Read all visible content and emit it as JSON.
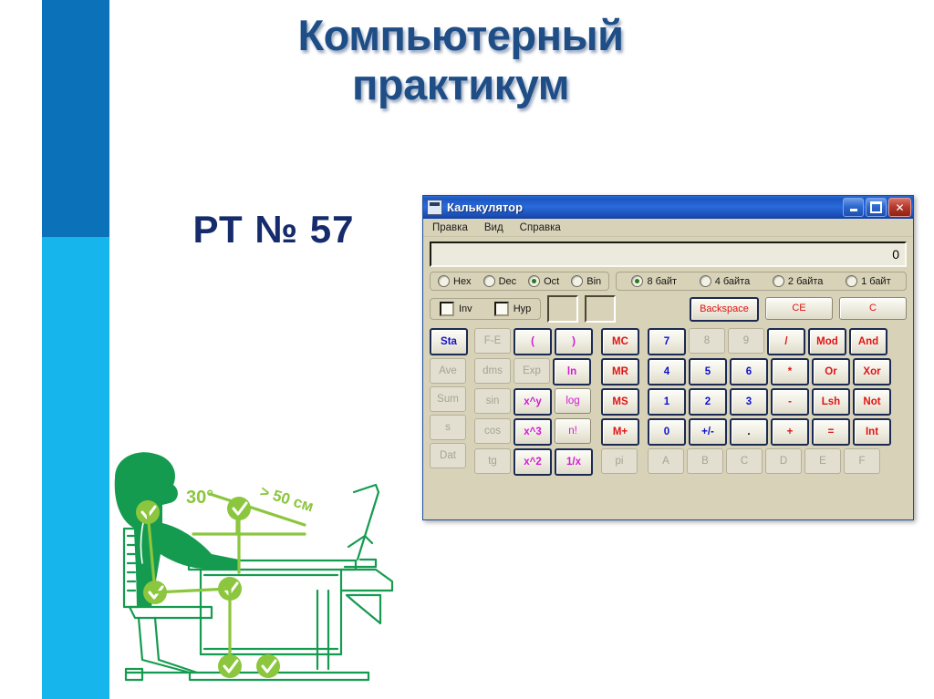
{
  "slide": {
    "title_line1": "Компьютерный",
    "title_line2": "практикум",
    "subtitle": "РТ № 57",
    "title_color": "#1f4e87",
    "subtitle_color": "#152b6b",
    "bar_dark_color": "#0b72ba",
    "bar_light_color": "#16b6ec"
  },
  "illustration": {
    "name": "ergonomic-desk-posture-diagram",
    "angle_label": "30°",
    "distance_label": "> 50 см",
    "line_color": "#159b4f",
    "accent_color": "#8cc63e"
  },
  "calculator": {
    "window_title": "Калькулятор",
    "window_icon": "calculator-icon",
    "window_buttons": {
      "minimize": "minimize-icon",
      "maximize": "maximize-icon",
      "close": "✕"
    },
    "menu": [
      "Правка",
      "Вид",
      "Справка"
    ],
    "display_value": "0",
    "number_system": {
      "options": [
        "Hex",
        "Dec",
        "Oct",
        "Bin"
      ],
      "selected": "Oct"
    },
    "word_size": {
      "options": [
        "8 байт",
        "4 байта",
        "2 байта",
        "1 байт"
      ],
      "selected": "8 байт"
    },
    "flags": [
      {
        "label": "Inv",
        "checked": false
      },
      {
        "label": "Hyp",
        "checked": false
      }
    ],
    "indicators": [
      "",
      ""
    ],
    "edit_buttons": [
      {
        "label": "Backspace",
        "color": "red",
        "focus": true
      },
      {
        "label": "CE",
        "color": "red",
        "focus": false
      },
      {
        "label": "C",
        "color": "red",
        "focus": false
      }
    ],
    "keypad": {
      "stat_column": [
        {
          "label": "Sta",
          "color": "blue",
          "disabled": false,
          "focus": true
        },
        {
          "label": "Ave",
          "color": "black",
          "disabled": true,
          "focus": false
        },
        {
          "label": "Sum",
          "color": "black",
          "disabled": true,
          "focus": false
        },
        {
          "label": "s",
          "color": "black",
          "disabled": true,
          "focus": false
        },
        {
          "label": "Dat",
          "color": "black",
          "disabled": true,
          "focus": false
        }
      ],
      "func_block": [
        [
          {
            "label": "F-E",
            "color": "black",
            "disabled": true,
            "focus": false
          },
          {
            "label": "(",
            "color": "magenta",
            "disabled": false,
            "focus": true
          },
          {
            "label": ")",
            "color": "magenta",
            "disabled": false,
            "focus": true
          }
        ],
        [
          {
            "label": "dms",
            "color": "black",
            "disabled": true,
            "focus": false
          },
          {
            "label": "Exp",
            "color": "black",
            "disabled": true,
            "focus": false
          },
          {
            "label": "ln",
            "color": "magenta",
            "disabled": false,
            "focus": true
          }
        ],
        [
          {
            "label": "sin",
            "color": "black",
            "disabled": true,
            "focus": false
          },
          {
            "label": "x^y",
            "color": "magenta",
            "disabled": false,
            "focus": true
          },
          {
            "label": "log",
            "color": "magenta",
            "disabled": false,
            "focus": false
          }
        ],
        [
          {
            "label": "cos",
            "color": "black",
            "disabled": true,
            "focus": false
          },
          {
            "label": "x^3",
            "color": "magenta",
            "disabled": false,
            "focus": true
          },
          {
            "label": "n!",
            "color": "magenta",
            "disabled": false,
            "focus": false
          }
        ],
        [
          {
            "label": "tg",
            "color": "black",
            "disabled": true,
            "focus": false
          },
          {
            "label": "x^2",
            "color": "magenta",
            "disabled": false,
            "focus": true
          },
          {
            "label": "1/x",
            "color": "magenta",
            "disabled": false,
            "focus": true
          }
        ]
      ],
      "memory_column": [
        {
          "label": "MC",
          "color": "red",
          "disabled": false,
          "focus": true
        },
        {
          "label": "MR",
          "color": "red",
          "disabled": false,
          "focus": true
        },
        {
          "label": "MS",
          "color": "red",
          "disabled": false,
          "focus": true
        },
        {
          "label": "M+",
          "color": "red",
          "disabled": false,
          "focus": true
        },
        {
          "label": "pi",
          "color": "black",
          "disabled": true,
          "focus": false
        }
      ],
      "main_block": [
        [
          {
            "label": "7",
            "color": "blue",
            "disabled": false,
            "focus": true
          },
          {
            "label": "8",
            "color": "black",
            "disabled": true,
            "focus": false
          },
          {
            "label": "9",
            "color": "black",
            "disabled": true,
            "focus": false
          },
          {
            "label": "/",
            "color": "red",
            "disabled": false,
            "focus": true
          },
          {
            "label": "Mod",
            "color": "red",
            "disabled": false,
            "focus": true
          },
          {
            "label": "And",
            "color": "red",
            "disabled": false,
            "focus": true
          }
        ],
        [
          {
            "label": "4",
            "color": "blue",
            "disabled": false,
            "focus": true
          },
          {
            "label": "5",
            "color": "blue",
            "disabled": false,
            "focus": true
          },
          {
            "label": "6",
            "color": "blue",
            "disabled": false,
            "focus": true
          },
          {
            "label": "*",
            "color": "red",
            "disabled": false,
            "focus": true
          },
          {
            "label": "Or",
            "color": "red",
            "disabled": false,
            "focus": true
          },
          {
            "label": "Xor",
            "color": "red",
            "disabled": false,
            "focus": true
          }
        ],
        [
          {
            "label": "1",
            "color": "blue",
            "disabled": false,
            "focus": true
          },
          {
            "label": "2",
            "color": "blue",
            "disabled": false,
            "focus": true
          },
          {
            "label": "3",
            "color": "blue",
            "disabled": false,
            "focus": true
          },
          {
            "label": "-",
            "color": "red",
            "disabled": false,
            "focus": true
          },
          {
            "label": "Lsh",
            "color": "red",
            "disabled": false,
            "focus": true
          },
          {
            "label": "Not",
            "color": "red",
            "disabled": false,
            "focus": true
          }
        ],
        [
          {
            "label": "0",
            "color": "blue",
            "disabled": false,
            "focus": true
          },
          {
            "label": "+/-",
            "color": "blue",
            "disabled": false,
            "focus": true
          },
          {
            "label": ".",
            "color": "black",
            "disabled": false,
            "focus": true
          },
          {
            "label": "+",
            "color": "red",
            "disabled": false,
            "focus": true
          },
          {
            "label": "=",
            "color": "red",
            "disabled": false,
            "focus": true
          },
          {
            "label": "Int",
            "color": "red",
            "disabled": false,
            "focus": true
          }
        ],
        [
          {
            "label": "A",
            "color": "black",
            "disabled": true,
            "focus": false
          },
          {
            "label": "B",
            "color": "black",
            "disabled": true,
            "focus": false
          },
          {
            "label": "C",
            "color": "black",
            "disabled": true,
            "focus": false
          },
          {
            "label": "D",
            "color": "black",
            "disabled": true,
            "focus": false
          },
          {
            "label": "E",
            "color": "black",
            "disabled": true,
            "focus": false
          },
          {
            "label": "F",
            "color": "black",
            "disabled": true,
            "focus": false
          }
        ]
      ]
    }
  }
}
